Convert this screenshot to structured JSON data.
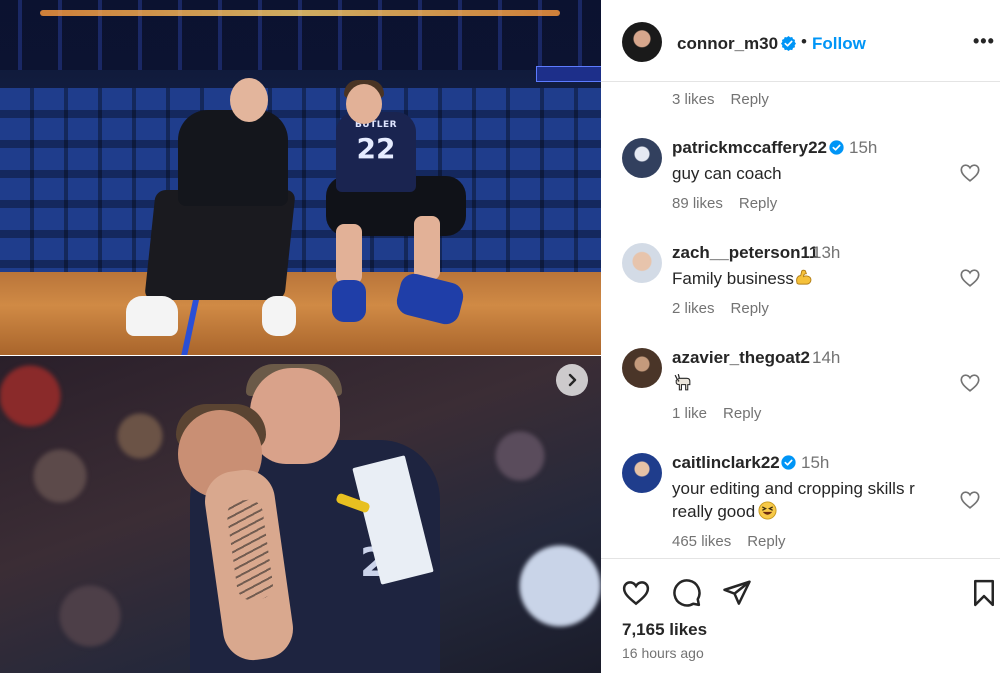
{
  "post": {
    "username": "connor_m30",
    "follow_label": "Follow",
    "separator": "•",
    "more_label": "•••",
    "jersey_team": "BUTLER",
    "jersey_number": "22",
    "hug_number": "22"
  },
  "first_comment_meta": {
    "likes": "3 likes",
    "reply_label": "Reply"
  },
  "comments": [
    {
      "username": "patrickmccaffery22",
      "verified": true,
      "time": "15h",
      "text": "guy can coach",
      "emoji": "",
      "likes": "89 likes",
      "reply_label": "Reply"
    },
    {
      "username": "zach__peterson11",
      "verified": false,
      "time": "13h",
      "text": "Family business",
      "emoji": "flexed-biceps",
      "likes": "2 likes",
      "reply_label": "Reply"
    },
    {
      "username": "azavier_thegoat2",
      "verified": false,
      "time": "14h",
      "text": "",
      "emoji": "goat",
      "likes": "1 like",
      "reply_label": "Reply"
    },
    {
      "username": "caitlinclark22",
      "verified": true,
      "time": "15h",
      "text": "your editing and cropping skills r really good",
      "emoji": "grinning-squinting-face",
      "likes": "465 likes",
      "reply_label": "Reply"
    }
  ],
  "footer": {
    "likes_count": "7,165 likes",
    "posted": "16 hours ago"
  },
  "colors": {
    "accent": "#0095f6",
    "verified": "#0095f6",
    "muted": "#737373",
    "text": "#262626"
  },
  "icons": [
    "next-arrow-icon",
    "verified-icon",
    "more-options-icon",
    "heart-icon",
    "comment-icon",
    "share-icon",
    "bookmark-icon"
  ]
}
